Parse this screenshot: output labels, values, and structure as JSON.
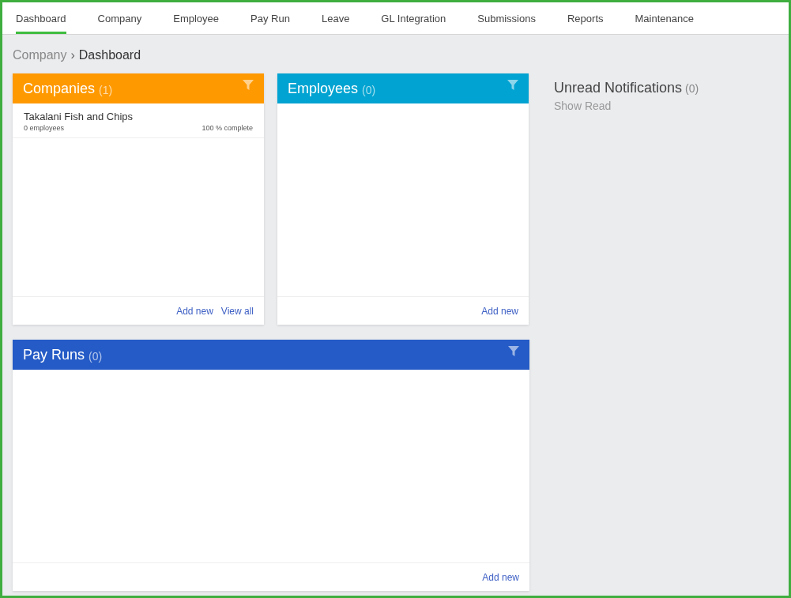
{
  "nav": [
    {
      "label": "Dashboard",
      "selected": true
    },
    {
      "label": "Company",
      "selected": false
    },
    {
      "label": "Employee",
      "selected": false
    },
    {
      "label": "Pay Run",
      "selected": false
    },
    {
      "label": "Leave",
      "selected": false
    },
    {
      "label": "GL Integration",
      "selected": false
    },
    {
      "label": "Submissions",
      "selected": false
    },
    {
      "label": "Reports",
      "selected": false
    },
    {
      "label": "Maintenance",
      "selected": false
    }
  ],
  "breadcrumb": {
    "parent": "Company",
    "separator": "›",
    "current": "Dashboard"
  },
  "panels": [
    {
      "title": "Companies",
      "count": "(1)",
      "color": "#ff9900",
      "items": [
        {
          "name": "Takalani Fish and Chips",
          "detail": "0 employees",
          "progress": "100 % complete"
        }
      ],
      "links": [
        "Add new",
        "View all"
      ]
    },
    {
      "title": "Employees",
      "count": "(0)",
      "color": "#00a3d1",
      "links": [
        "Add new"
      ]
    },
    {
      "title": "Pay Runs",
      "count": "(0)",
      "color": "#255bc6",
      "links": [
        "Add new"
      ]
    }
  ],
  "notifications": {
    "title": "Unread Notifications",
    "count": "(0)",
    "link": "Show Read"
  }
}
